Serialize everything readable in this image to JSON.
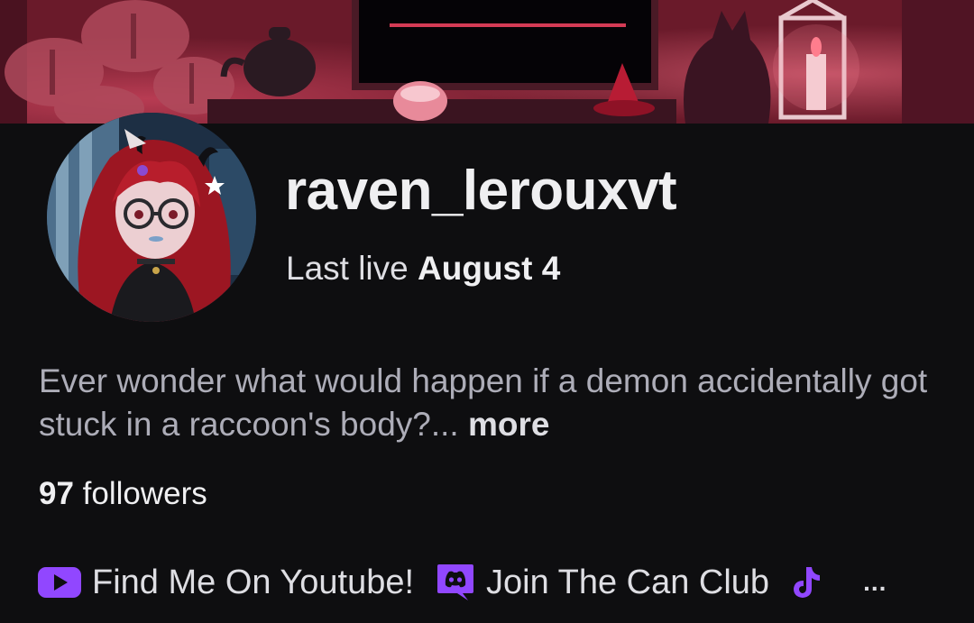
{
  "profile": {
    "channel_name": "raven_lerouxvt",
    "last_live_prefix": "Last live",
    "last_live_date": "August 4",
    "bio_text": "Ever wonder what would happen if a demon accidentally got stuck in a raccoon's body?",
    "bio_ellipsis": "...",
    "bio_more_label": "more",
    "followers_count": "97",
    "followers_label": "followers"
  },
  "social_links": [
    {
      "icon": "youtube-icon",
      "label": "Find Me On Youtube!"
    },
    {
      "icon": "discord-icon",
      "label": "Join The Can Club"
    },
    {
      "icon": "tiktok-icon",
      "label": ""
    }
  ],
  "overflow_label": "...",
  "colors": {
    "background": "#0e0e10",
    "text_primary": "#efeff1",
    "text_secondary": "#adadb8",
    "accent_purple": "#9147ff",
    "banner_red": "#7a1f30"
  }
}
